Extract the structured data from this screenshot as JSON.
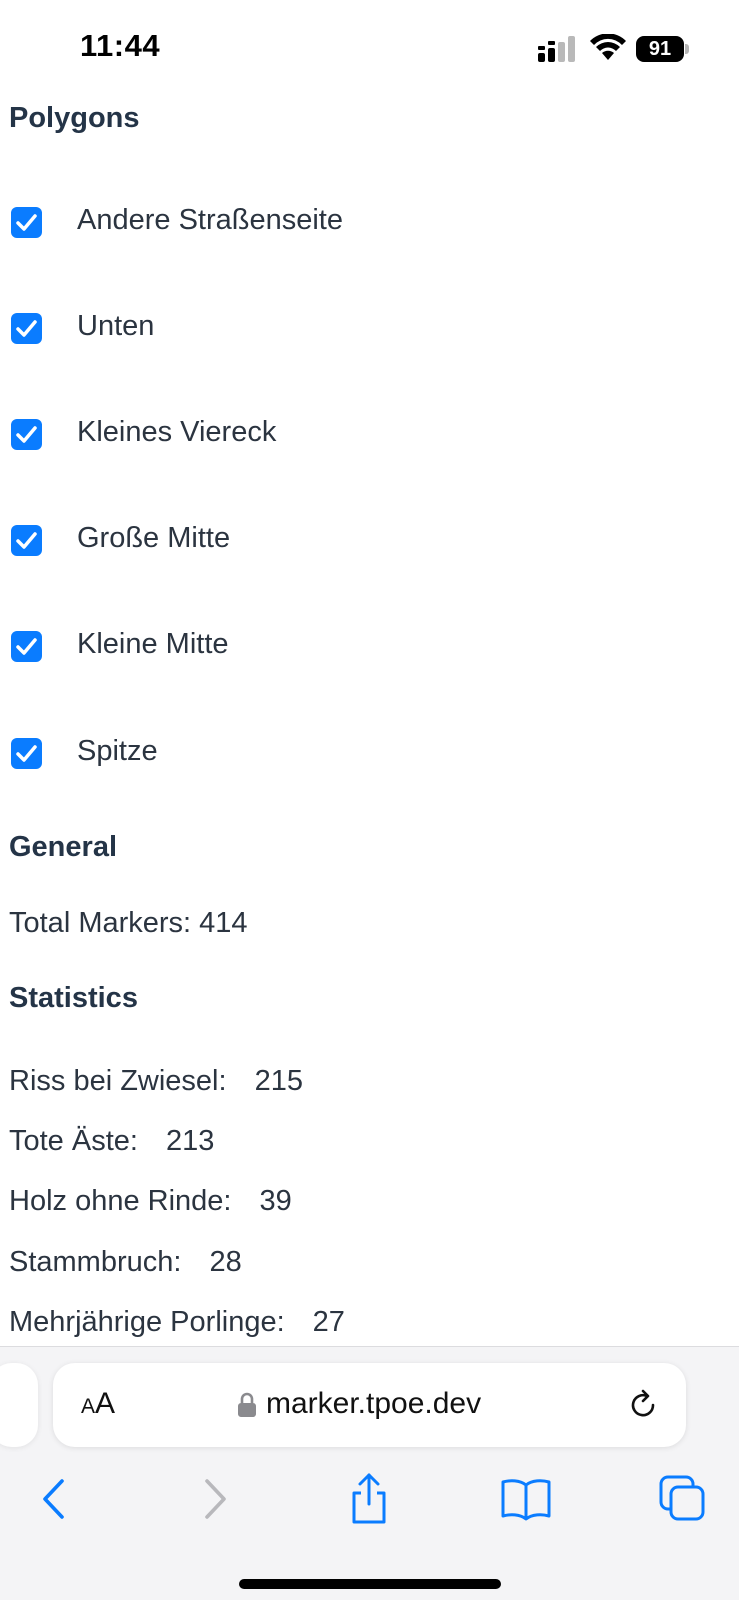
{
  "status_bar": {
    "time": "11:44",
    "battery": "91",
    "signal_icon": "cellular-signal-icon",
    "wifi_icon": "wifi-icon"
  },
  "polygons": {
    "heading": "Polygons",
    "items": [
      {
        "label": "Andere Straßenseite",
        "checked": true
      },
      {
        "label": "Unten",
        "checked": true
      },
      {
        "label": "Kleines Viereck",
        "checked": true
      },
      {
        "label": "Große Mitte",
        "checked": true
      },
      {
        "label": "Kleine Mitte",
        "checked": true
      },
      {
        "label": "Spitze",
        "checked": true
      }
    ]
  },
  "general": {
    "heading": "General",
    "total_markers": "Total Markers: 414"
  },
  "statistics": {
    "heading": "Statistics",
    "rows": [
      {
        "label": "Riss bei Zwiesel:",
        "value": "215"
      },
      {
        "label": "Tote Äste:",
        "value": "213"
      },
      {
        "label": "Holz ohne Rinde:",
        "value": "39"
      },
      {
        "label": "Stammbruch:",
        "value": "28"
      },
      {
        "label": "Mehrjährige Porlinge:",
        "value": "27"
      }
    ]
  },
  "browser": {
    "text_size_small": "A",
    "text_size_large": "A",
    "url": "marker.tpoe.dev",
    "accent_color": "#0a7cff"
  }
}
